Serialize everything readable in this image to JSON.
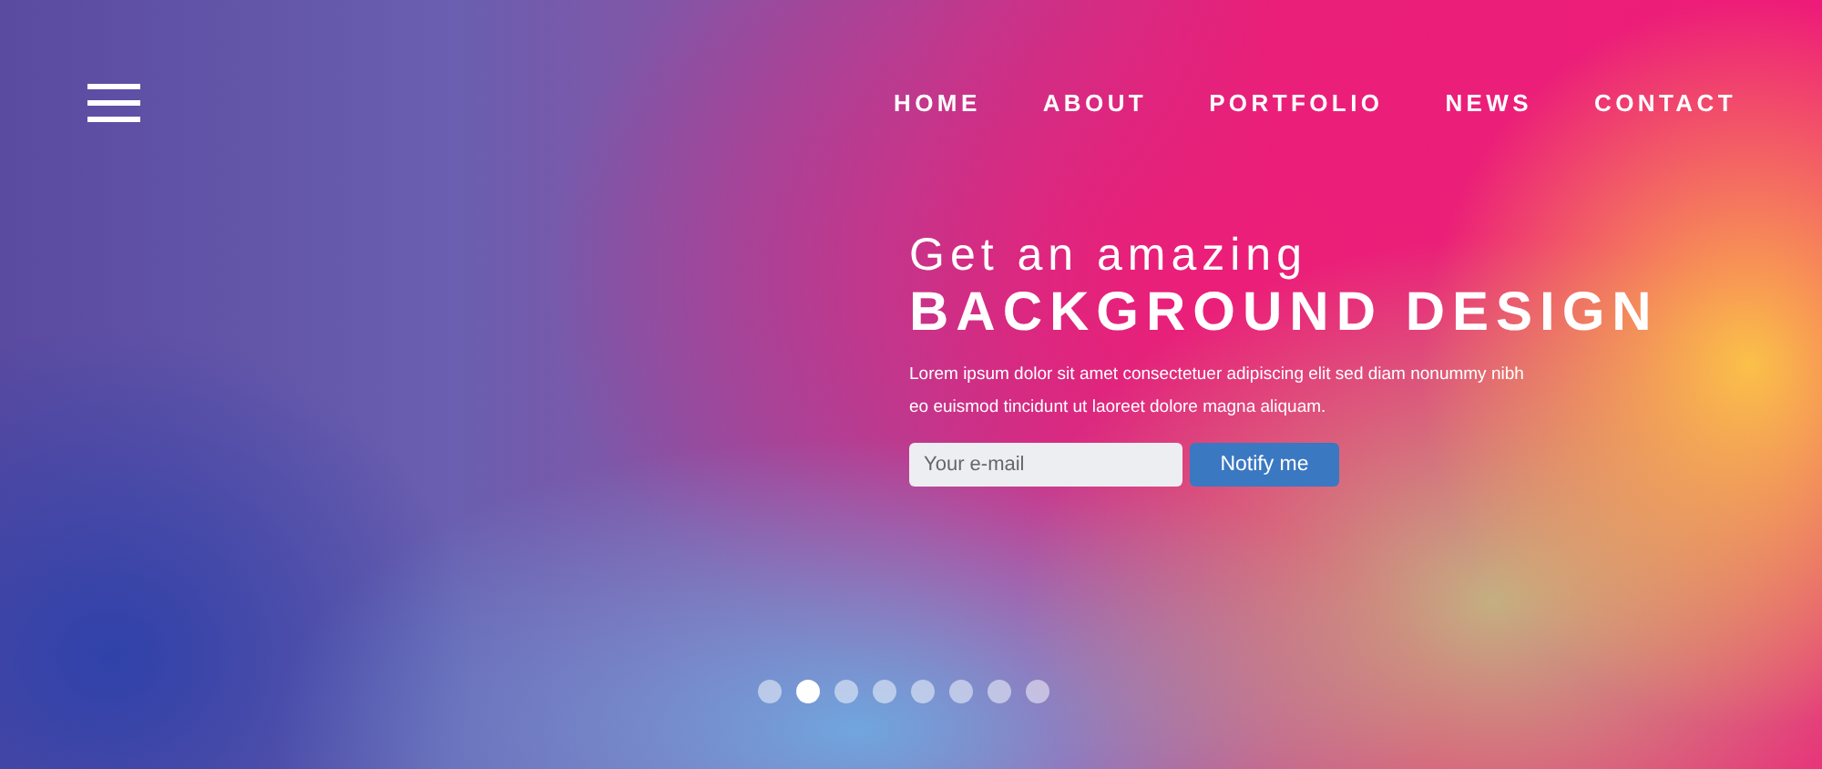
{
  "nav": {
    "links": [
      {
        "label": "HOME"
      },
      {
        "label": "ABOUT"
      },
      {
        "label": "PORTFOLIO"
      },
      {
        "label": "NEWS"
      },
      {
        "label": "CONTACT"
      }
    ]
  },
  "hero": {
    "kicker": "Get an amazing",
    "title": "BACKGROUND DESIGN",
    "text": "Lorem ipsum dolor sit amet consectetuer adipiscing elit sed diam nonummy nibh eo euismod tincidunt ut laoreet dolore magna aliquam.",
    "email": {
      "placeholder": "Your e-mail"
    },
    "button": "Notify me"
  },
  "slider_dots": [
    {
      "selected": false
    },
    {
      "selected": true
    },
    {
      "selected": false
    },
    {
      "selected": false
    },
    {
      "selected": false
    },
    {
      "selected": false
    },
    {
      "selected": false
    },
    {
      "selected": false
    }
  ]
}
